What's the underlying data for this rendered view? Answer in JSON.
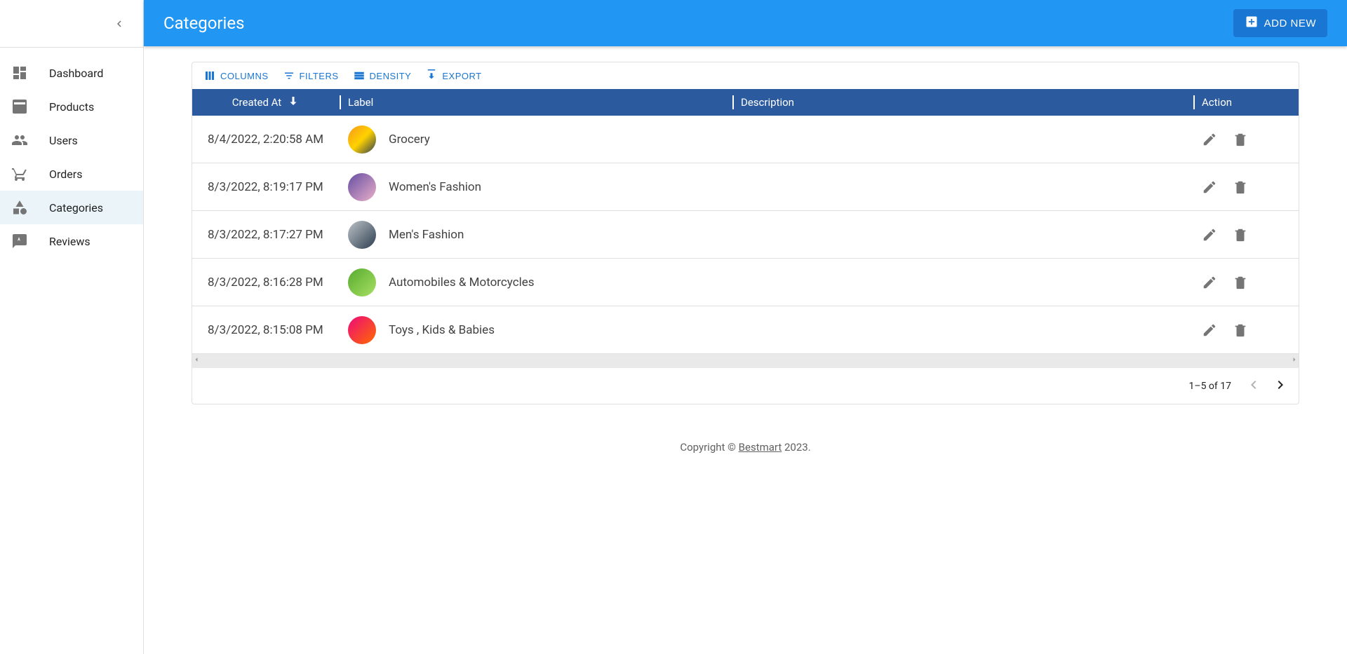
{
  "sidebar": {
    "items": [
      {
        "label": "Dashboard",
        "icon": "dashboard"
      },
      {
        "label": "Products",
        "icon": "inbox"
      },
      {
        "label": "Users",
        "icon": "group"
      },
      {
        "label": "Orders",
        "icon": "cart"
      },
      {
        "label": "Categories",
        "icon": "category",
        "active": true
      },
      {
        "label": "Reviews",
        "icon": "comment"
      }
    ]
  },
  "header": {
    "title": "Categories",
    "add_label": "ADD NEW"
  },
  "toolbar": {
    "columns": "COLUMNS",
    "filters": "FILTERS",
    "density": "DENSITY",
    "export": "EXPORT"
  },
  "columns": {
    "created_at": "Created At",
    "label": "Label",
    "description": "Description",
    "action": "Action"
  },
  "rows": [
    {
      "created_at": "8/4/2022, 2:20:58 AM",
      "label": "Grocery"
    },
    {
      "created_at": "8/3/2022, 8:19:17 PM",
      "label": "Women's Fashion"
    },
    {
      "created_at": "8/3/2022, 8:17:27 PM",
      "label": "Men's Fashion"
    },
    {
      "created_at": "8/3/2022, 8:16:28 PM",
      "label": "Automobiles & Motorcycles"
    },
    {
      "created_at": "8/3/2022, 8:15:08 PM",
      "label": "Toys , Kids & Babies"
    }
  ],
  "pagination": {
    "range": "1–5 of 17"
  },
  "footer": {
    "prefix": "Copyright © ",
    "brand": "Bestmart",
    "suffix": " 2023."
  }
}
